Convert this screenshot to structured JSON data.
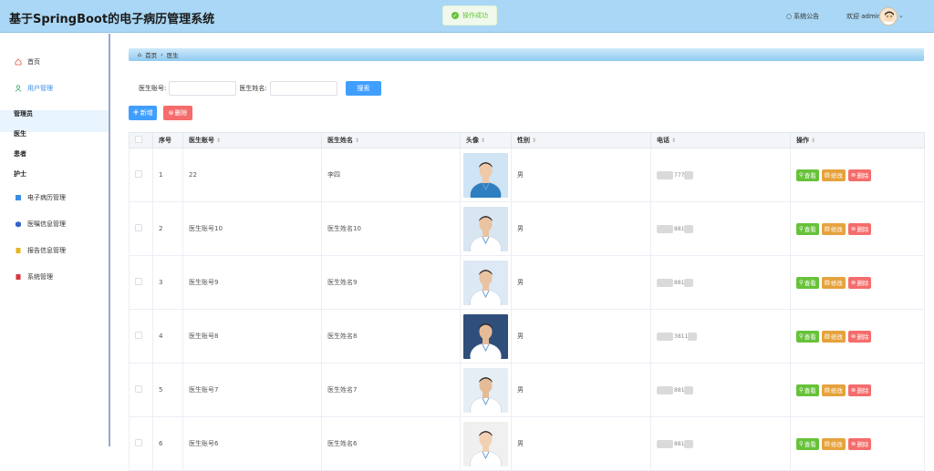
{
  "header": {
    "title": "基于SpringBoot的电子病历管理系统",
    "toast": "操作成功",
    "notice": "系统公告",
    "welcome": "欢迎 admin"
  },
  "sidebar": {
    "home": "首页",
    "user_mgmt": "用户管理",
    "subs": [
      "管理员",
      "医生",
      "患者",
      "护士"
    ],
    "emr": "电子病历管理",
    "orders": "医嘱信息管理",
    "reports": "报告信息管理",
    "system": "系统管理"
  },
  "breadcrumb": {
    "home": "首页",
    "current": "医生"
  },
  "search": {
    "account_label": "医生账号:",
    "name_label": "医生姓名:",
    "button": "搜索"
  },
  "actions": {
    "add": "新增",
    "delete": "删除"
  },
  "table": {
    "columns": [
      "序号",
      "医生账号",
      "医生姓名",
      "头像",
      "性别",
      "电话",
      "操作"
    ],
    "rows": [
      {
        "no": "1",
        "account": "22",
        "name": "李四",
        "gender": "男",
        "phone": "777"
      },
      {
        "no": "2",
        "account": "医生账号10",
        "name": "医生姓名10",
        "gender": "男",
        "phone": "881"
      },
      {
        "no": "3",
        "account": "医生账号9",
        "name": "医生姓名9",
        "gender": "男",
        "phone": "881"
      },
      {
        "no": "4",
        "account": "医生账号8",
        "name": "医生姓名8",
        "gender": "男",
        "phone": "3811"
      },
      {
        "no": "5",
        "account": "医生账号7",
        "name": "医生姓名7",
        "gender": "男",
        "phone": "881"
      },
      {
        "no": "6",
        "account": "医生账号6",
        "name": "医生姓名6",
        "gender": "男",
        "phone": "881"
      }
    ],
    "op_view": "查看",
    "op_edit": "修改",
    "op_delete": "删除"
  },
  "colors": {
    "primary": "#409eff",
    "success": "#67c23a",
    "warning": "#e6a23c",
    "danger": "#f56c6c",
    "header_bg": "#a9d7f5"
  }
}
